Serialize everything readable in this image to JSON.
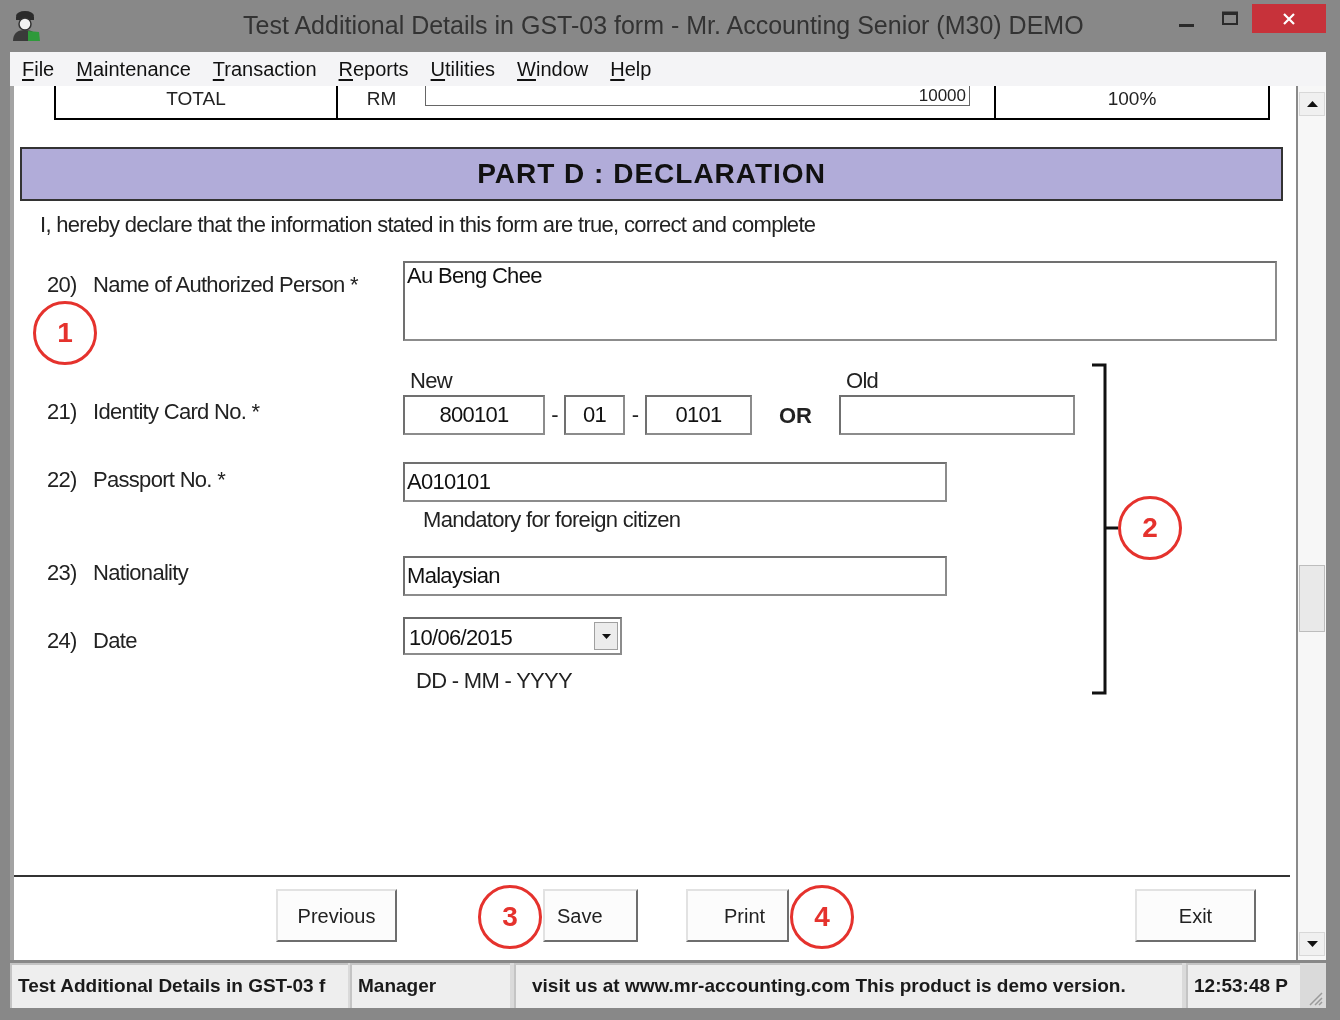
{
  "window": {
    "title": "Test Additional Details in GST-03 form - Mr. Accounting Senior (M30) DEMO"
  },
  "menu": [
    "File",
    "Maintenance",
    "Transaction",
    "Reports",
    "Utilities",
    "Window",
    "Help"
  ],
  "summary_row": {
    "label": "TOTAL",
    "currency": "RM",
    "amount": "10000",
    "percent": "100%"
  },
  "section": {
    "title": "PART D : DECLARATION",
    "statement": "I, hereby declare that the information stated in this form are true, correct and complete"
  },
  "fields": [
    {
      "number": "20)",
      "label": "Name of Authorized Person *",
      "kind": "textarea",
      "value": "Au Beng Chee"
    },
    {
      "number": "21)",
      "label": "Identity Card No. *",
      "kind": "ic",
      "new_label": "New",
      "new_parts": [
        "800101",
        "01",
        "0101"
      ],
      "separators": [
        "-",
        "-"
      ],
      "or_label": "OR",
      "old_label": "Old"
    },
    {
      "number": "22)",
      "label": "Passport No. *",
      "kind": "text",
      "value": "A010101",
      "hint": "Mandatory for foreign citizen"
    },
    {
      "number": "23)",
      "label": "Nationality",
      "kind": "text",
      "value": "Malaysian"
    },
    {
      "number": "24)",
      "label": "Date",
      "kind": "date",
      "value": "10/06/2015",
      "hint": "DD - MM - YYYY"
    }
  ],
  "buttons": [
    "Previous",
    "Save",
    "Print",
    "Exit"
  ],
  "status_bar": [
    "Test Additional Details in GST-03 f",
    "Manager",
    "visit us at www.mr-accounting.com This product is demo version.",
    "12:53:48 P"
  ],
  "callouts": [
    "1",
    "2",
    "3",
    "4"
  ]
}
